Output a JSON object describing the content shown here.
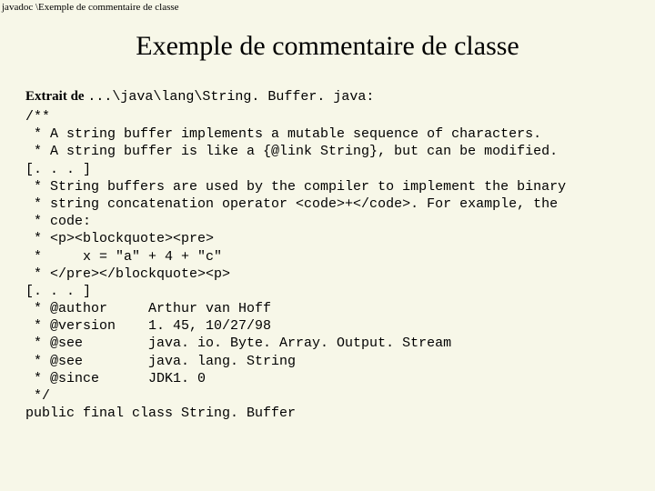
{
  "breadcrumb": "javadoc \\Exemple de commentaire de classe",
  "title": "Exemple de commentaire de classe",
  "extract_label": "Extrait de ",
  "extract_path": "...\\java\\lang\\String. Buffer. java: ",
  "code": "/**\n * A string buffer implements a mutable sequence of characters.\n * A string buffer is like a {@link String}, but can be modified.\n[. . . ]\n * String buffers are used by the compiler to implement the binary\n * string concatenation operator <code>+</code>. For example, the\n * code:\n * <p><blockquote><pre>\n *     x = \"a\" + 4 + \"c\"\n * </pre></blockquote><p>\n[. . . ]\n * @author     Arthur van Hoff\n * @version    1. 45, 10/27/98\n * @see        java. io. Byte. Array. Output. Stream\n * @see        java. lang. String\n * @since      JDK1. 0\n */\npublic final class String. Buffer"
}
